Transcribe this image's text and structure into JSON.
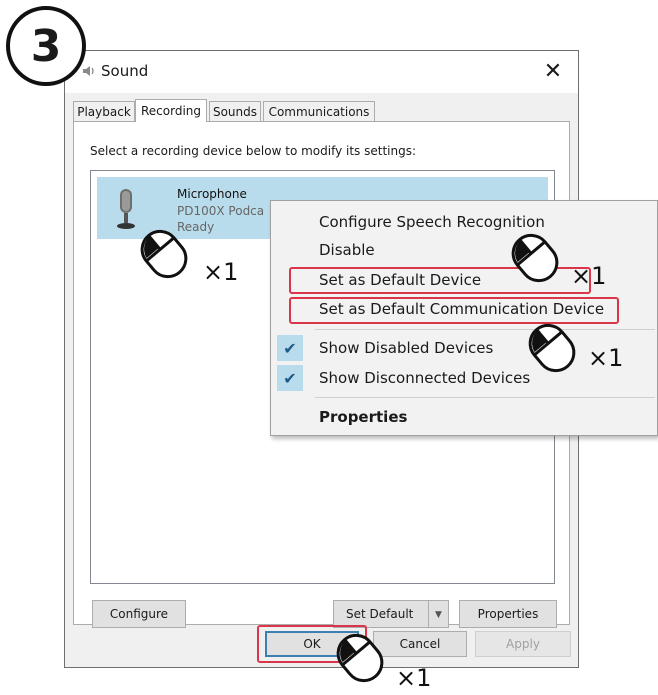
{
  "step": {
    "number": "3"
  },
  "window": {
    "title": "Sound",
    "tabs": [
      {
        "label": "Playback"
      },
      {
        "label": "Recording"
      },
      {
        "label": "Sounds"
      },
      {
        "label": "Communications"
      }
    ],
    "instruction": "Select a recording device below to modify its settings:",
    "device": {
      "name": "Microphone",
      "description": "PD100X Podca",
      "status": "Ready"
    },
    "buttons": {
      "configure": "Configure",
      "set_default": "Set Default",
      "properties": "Properties",
      "ok": "OK",
      "cancel": "Cancel",
      "apply": "Apply"
    }
  },
  "context_menu": {
    "items": [
      {
        "label": "Configure Speech Recognition"
      },
      {
        "label": "Disable"
      },
      {
        "label": "Set as Default Device"
      },
      {
        "label": "Set as Default Communication Device"
      },
      {
        "label": "Show Disabled Devices",
        "checked": true
      },
      {
        "label": "Show Disconnected Devices",
        "checked": true
      },
      {
        "label": "Properties"
      }
    ]
  },
  "annotations": {
    "click_count": "×1",
    "highlight_color": "#d9364a"
  }
}
